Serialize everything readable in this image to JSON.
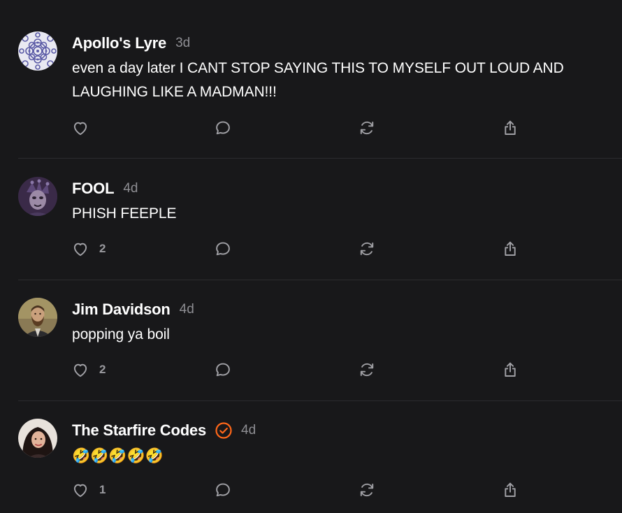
{
  "comments": [
    {
      "author": "Apollo's Lyre",
      "time": "3d",
      "text": "even a day later I CANT STOP SAYING THIS TO MYSELF OUT LOUD AND LAUGHING LIKE A MADMAN!!!",
      "likes": "",
      "verified": false
    },
    {
      "author": "FOOL",
      "time": "4d",
      "text": "PHISH FEEPLE",
      "likes": "2",
      "verified": false
    },
    {
      "author": "Jim Davidson",
      "time": "4d",
      "text": "popping ya boil",
      "likes": "2",
      "verified": false
    },
    {
      "author": "The Starfire Codes",
      "time": "4d",
      "text": "🤣🤣🤣🤣🤣",
      "likes": "1",
      "verified": true
    }
  ],
  "icons": {
    "like": "heart-icon",
    "reply": "speech-bubble-icon",
    "restack": "restack-arrows-icon",
    "share": "share-icon",
    "verified": "verified-check-icon"
  },
  "colors": {
    "background": "#18181a",
    "text": "#ffffff",
    "muted": "#8e8e93",
    "icon": "#a0a0a5",
    "divider": "#2c2c2f",
    "verified": "#ff6719"
  }
}
